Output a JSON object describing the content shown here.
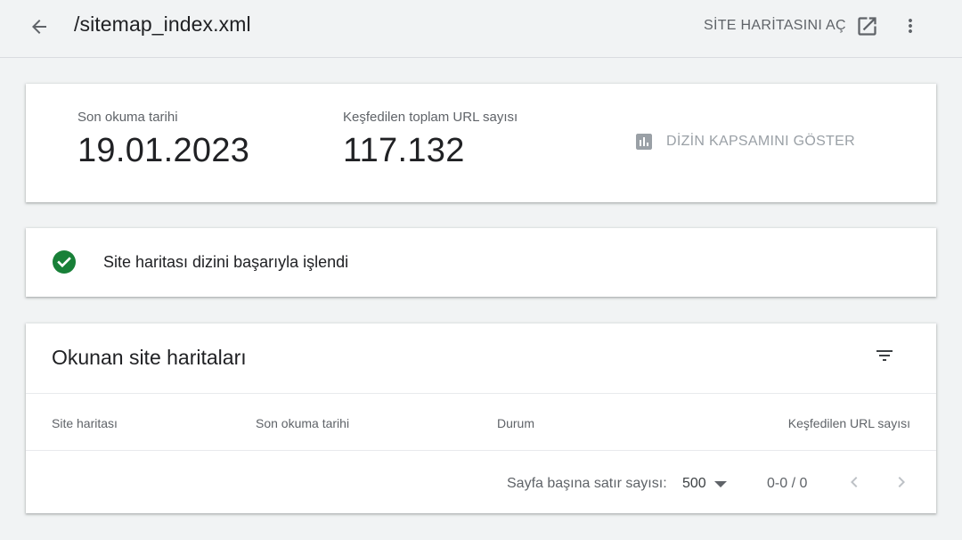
{
  "header": {
    "title": "/sitemap_index.xml",
    "open_sitemap_label": "SİTE HARİTASINI AÇ",
    "icons": {
      "back": "arrow-back-icon",
      "open": "open-in-new-icon",
      "more": "more-vert-icon"
    }
  },
  "summary": {
    "last_read_label": "Son okuma tarihi",
    "last_read_value": "19.01.2023",
    "urls_label": "Keşfedilen toplam URL sayısı",
    "urls_value": "117.132",
    "coverage_button_label": "DİZİN KAPSAMINI GÖSTER",
    "coverage_icon": "bar-chart-icon"
  },
  "status": {
    "text": "Site haritası dizini başarıyla işlendi",
    "icon": "check-circle-icon",
    "color": "#188038"
  },
  "table": {
    "title": "Okunan site haritaları",
    "filter_icon": "filter-list-icon",
    "columns": [
      "Site haritası",
      "Son okuma tarihi",
      "Durum",
      "Keşfedilen URL sayısı"
    ],
    "rows": [],
    "pagination": {
      "rows_per_page_label": "Sayfa başına satır sayısı:",
      "rows_per_page_value": "500",
      "range_text": "0-0 / 0"
    }
  },
  "colors": {
    "background": "#f1f3f4",
    "card": "#ffffff",
    "success": "#188038",
    "muted_text": "#5f6368",
    "disabled": "#9aa0a6"
  }
}
